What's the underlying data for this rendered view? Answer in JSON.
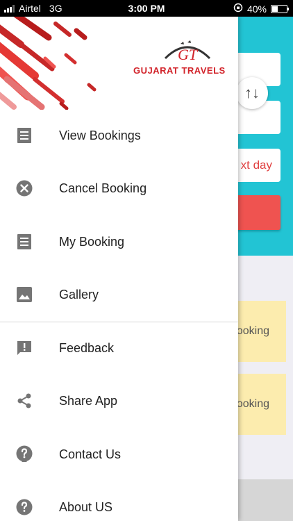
{
  "status_bar": {
    "carrier": "Airtel",
    "network": "3G",
    "time": "3:00 PM",
    "battery": "40%"
  },
  "background": {
    "date_hint": "xt day",
    "card_text_1": "ooking",
    "card_text_2": "ooking"
  },
  "drawer": {
    "brand": "GUJARAT TRAVELS",
    "brand_initials": "GT",
    "menu": [
      {
        "label": "View Bookings",
        "icon": "receipt-icon"
      },
      {
        "label": "Cancel Booking",
        "icon": "cancel-circle-icon"
      },
      {
        "label": "My Booking",
        "icon": "receipt-icon"
      },
      {
        "label": "Gallery",
        "icon": "image-icon"
      },
      {
        "label": "Feedback",
        "icon": "feedback-icon"
      },
      {
        "label": "Share App",
        "icon": "share-icon"
      },
      {
        "label": "Contact Us",
        "icon": "help-icon"
      },
      {
        "label": "About US",
        "icon": "help-circle-icon"
      }
    ]
  },
  "colors": {
    "brand_red": "#d2232a",
    "accent_teal": "#22c4d4",
    "icon_grey": "#757575"
  }
}
